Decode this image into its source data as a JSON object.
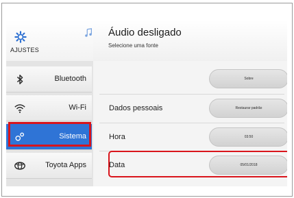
{
  "settings": {
    "label": "AJUSTES"
  },
  "header": {
    "title": "Áudio desligado",
    "subtitle": "Selecione uma fonte"
  },
  "sidebar": {
    "items": [
      {
        "label": "Bluetooth",
        "icon": "bluetooth-icon"
      },
      {
        "label": "Wi-Fi",
        "icon": "wifi-icon"
      },
      {
        "label": "Sistema",
        "icon": "system-icon",
        "selected": true
      },
      {
        "label": "Toyota Apps",
        "icon": "toyota-apps-icon"
      }
    ]
  },
  "rows": [
    {
      "label": "",
      "button": "Sobre"
    },
    {
      "label": "Dados pessoais",
      "button": "Restaurar padrão"
    },
    {
      "label": "Hora",
      "button": "03:50"
    },
    {
      "label": "Data",
      "button": "05/01/2018"
    }
  ],
  "colors": {
    "accent": "#2f74d6",
    "highlight": "#d9141b"
  }
}
